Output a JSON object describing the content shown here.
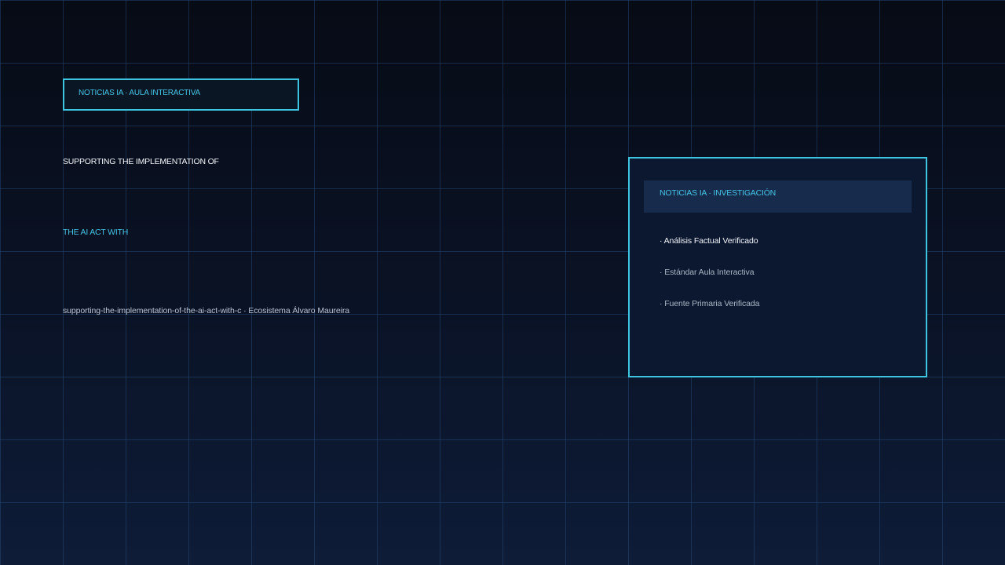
{
  "top_badge": {
    "label": "NOTICIAS IA · AULA INTERACTIVA"
  },
  "headline": {
    "line1": "SUPPORTING THE IMPLEMENTATION OF",
    "line2": "THE AI ACT WITH"
  },
  "slug": {
    "text": "supporting-the-implementation-of-the-ai-act-with-c · Ecosistema Álvaro Maureira"
  },
  "panel": {
    "header": "NOTICIAS IA · INVESTIGACIÓN",
    "items": [
      {
        "label": "· Análisis Factual Verificado"
      },
      {
        "label": "· Estándar Aula Interactiva"
      },
      {
        "label": "· Fuente Primaria Verificada"
      }
    ]
  },
  "colors": {
    "accent": "#3cc4e0",
    "background_top": "#070b16",
    "background_bottom": "#0e1c38",
    "panel": "#0c1830",
    "panel_header": "#172c4c"
  }
}
